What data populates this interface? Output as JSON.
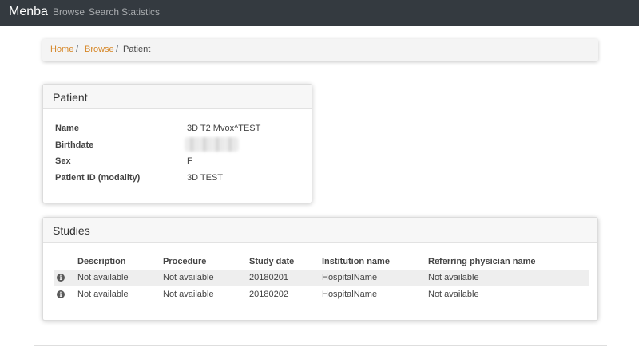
{
  "nav": {
    "brand": "Menba",
    "links": [
      "Browse",
      "Search",
      "Statistics"
    ]
  },
  "breadcrumb": {
    "items": [
      "Home",
      "Browse",
      "Patient"
    ],
    "separator": "/"
  },
  "patient": {
    "title": "Patient",
    "fields": [
      {
        "label": "Name",
        "value": "3D T2 Mvox^TEST"
      },
      {
        "label": "Birthdate",
        "value": ""
      },
      {
        "label": "Sex",
        "value": "F"
      },
      {
        "label": "Patient ID (modality)",
        "value": "3D TEST"
      }
    ]
  },
  "studies": {
    "title": "Studies",
    "columns": [
      "Description",
      "Procedure",
      "Study date",
      "Institution name",
      "Referring physician name"
    ],
    "rows": [
      [
        "Not available",
        "Not available",
        "20180201",
        "HospitalName",
        "Not available"
      ],
      [
        "Not available",
        "Not available",
        "20180202",
        "HospitalName",
        "Not available"
      ]
    ],
    "row_icon": "info-circle-icon",
    "row_icon_glyph": "i"
  },
  "colors": {
    "navbar": "#343a40",
    "breadcrumb_link": "#d68728",
    "row_highlight": "#eeeeee"
  }
}
